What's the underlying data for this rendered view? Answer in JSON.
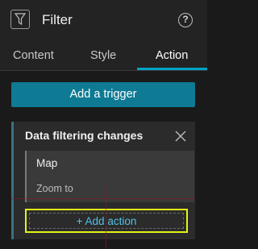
{
  "header": {
    "title": "Filter",
    "help_glyph": "?"
  },
  "tabs": [
    {
      "label": "Content"
    },
    {
      "label": "Style"
    },
    {
      "label": "Action"
    }
  ],
  "active_tab": "Action",
  "trigger_button": {
    "label": "Add a trigger"
  },
  "trigger_card": {
    "title": "Data filtering changes",
    "action": {
      "name": "Map",
      "detail": "Zoom to"
    },
    "add_action_label": "+ Add action"
  },
  "colors": {
    "accent": "#00a2c7",
    "button": "#0e7a94",
    "highlight": "#e3f317",
    "link": "#4fc3e6"
  },
  "icons": {
    "filter": "filter-icon",
    "help": "help-icon",
    "close": "close-icon"
  }
}
